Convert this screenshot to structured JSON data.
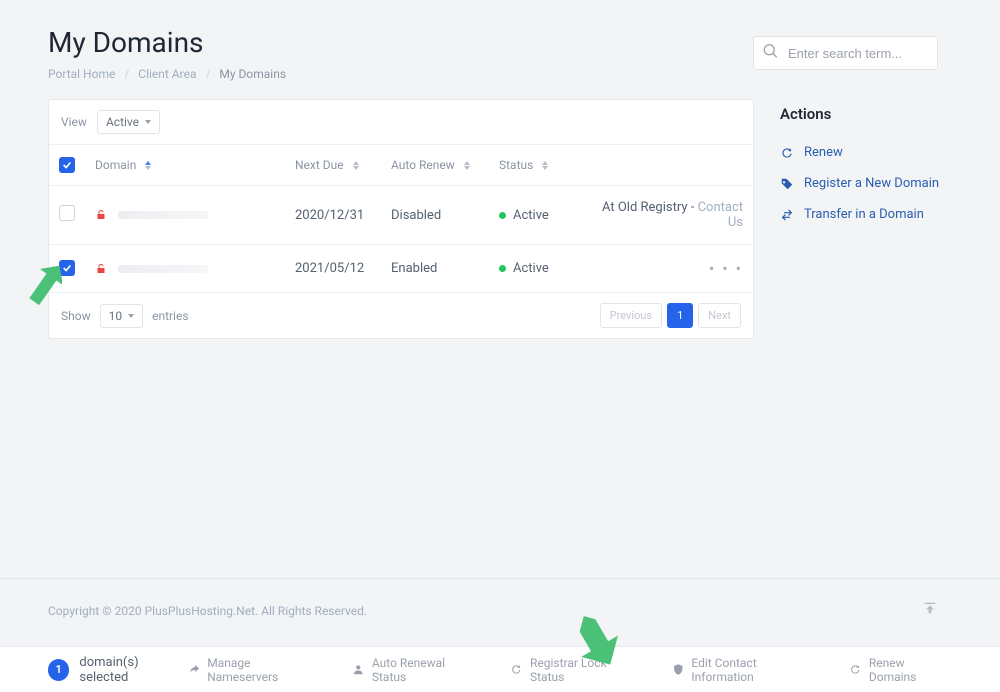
{
  "header": {
    "title": "My Domains"
  },
  "breadcrumbs": {
    "home": "Portal Home",
    "client_area": "Client Area",
    "current": "My Domains"
  },
  "search": {
    "placeholder": "Enter search term..."
  },
  "view": {
    "label": "View",
    "filter": "Active"
  },
  "table": {
    "headers": {
      "domain": "Domain",
      "next_due": "Next Due",
      "auto_renew": "Auto Renew",
      "status": "Status"
    },
    "rows": [
      {
        "checked": false,
        "next_due": "2020/12/31",
        "auto_renew": "Disabled",
        "status": "Active",
        "extra_label": "At Old Registry - ",
        "extra_cta": "Contact Us"
      },
      {
        "checked": true,
        "next_due": "2021/05/12",
        "auto_renew": "Enabled",
        "status": "Active",
        "extra_label": "",
        "extra_cta": ""
      }
    ]
  },
  "footer_panel": {
    "show": "Show",
    "size": "10",
    "entries": "entries",
    "prev": "Previous",
    "page": "1",
    "next": "Next"
  },
  "actions": {
    "title": "Actions",
    "renew": "Renew",
    "register": "Register a New Domain",
    "transfer": "Transfer in a Domain"
  },
  "copyright": "Copyright © 2020 PlusPlusHosting.Net. All Rights Reserved.",
  "selection_bar": {
    "count": "1",
    "selected_text": "domain(s) selected",
    "manage_ns": "Manage Nameservers",
    "auto_renewal": "Auto Renewal Status",
    "registrar_lock": "Registrar Lock Status",
    "edit_contact": "Edit Contact Information",
    "renew_domains": "Renew Domains"
  }
}
